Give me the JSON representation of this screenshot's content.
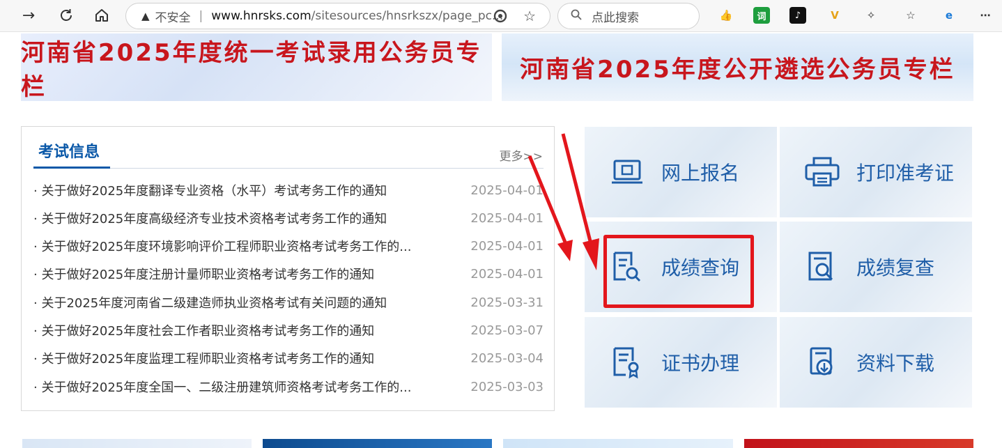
{
  "browser": {
    "insecure_label": "不安全",
    "url_host": "www.hnrsks.com",
    "url_path": "/sitesources/hnsrkszx/page_pc...",
    "search_placeholder": "点此搜索"
  },
  "banners": [
    {
      "text": "河南省2025年度统一考试录用公务员专栏"
    },
    {
      "text": "河南省2025年度公开遴选公务员专栏"
    }
  ],
  "news": {
    "title": "考试信息",
    "more": "更多>>",
    "items": [
      {
        "title": "· 关于做好2025年度翻译专业资格（水平）考试考务工作的通知",
        "date": "2025-04-01"
      },
      {
        "title": "· 关于做好2025年度高级经济专业技术资格考试考务工作的通知",
        "date": "2025-04-01"
      },
      {
        "title": "· 关于做好2025年度环境影响评价工程师职业资格考试考务工作的...",
        "date": "2025-04-01"
      },
      {
        "title": "· 关于做好2025年度注册计量师职业资格考试考务工作的通知",
        "date": "2025-04-01"
      },
      {
        "title": "· 关于2025年度河南省二级建造师执业资格考试有关问题的通知",
        "date": "2025-03-31"
      },
      {
        "title": "·  关于做好2025年度社会工作者职业资格考试考务工作的通知",
        "date": "2025-03-07"
      },
      {
        "title": "· 关于做好2025年度监理工程师职业资格考试考务工作的通知",
        "date": "2025-03-04"
      },
      {
        "title": "· 关于做好2025年度全国一、二级注册建筑师资格考试考务工作的...",
        "date": "2025-03-03"
      }
    ]
  },
  "services": [
    {
      "label": "网上报名",
      "icon": "online-register-icon"
    },
    {
      "label": "打印准考证",
      "icon": "printer-icon"
    },
    {
      "label": "成绩查询",
      "icon": "score-query-icon"
    },
    {
      "label": "成绩复查",
      "icon": "score-review-icon"
    },
    {
      "label": "证书办理",
      "icon": "certificate-icon"
    },
    {
      "label": "资料下载",
      "icon": "download-icon"
    }
  ],
  "colors": {
    "brand_blue": "#0a58a8",
    "tile_text": "#1f5ea8",
    "banner_red": "#c8161d",
    "highlight_red": "#e3161c"
  }
}
